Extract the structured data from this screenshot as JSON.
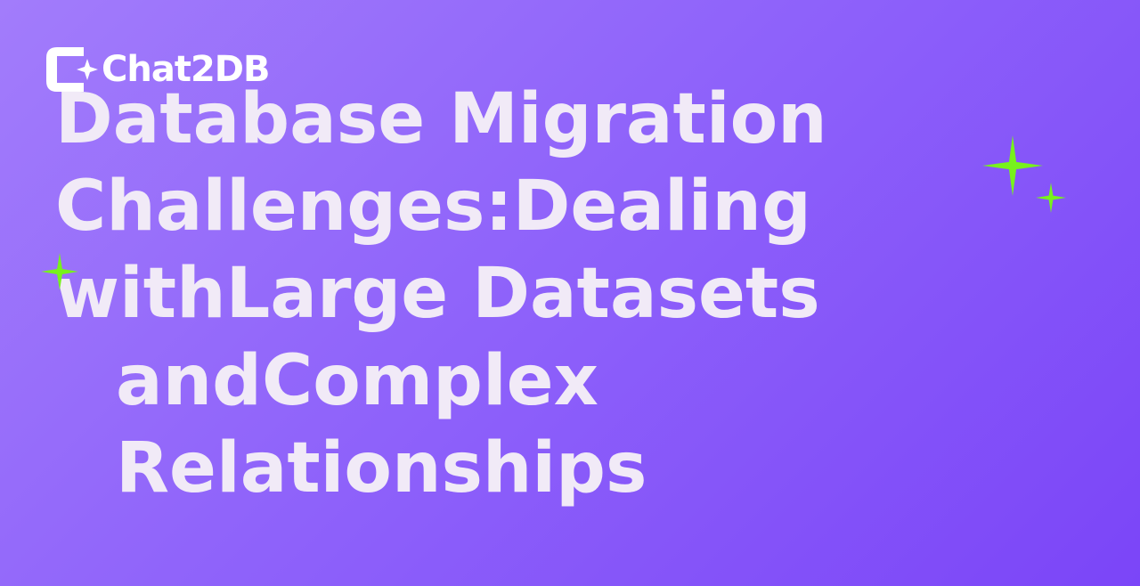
{
  "brand": {
    "name": "Chat2DB"
  },
  "title": {
    "lines": [
      "Database Migration",
      "Challenges:Dealing",
      "withLarge Datasets",
      "andComplex",
      "Relationships"
    ]
  },
  "colors": {
    "background_start": "#a27cfb",
    "background_end": "#7b45f8",
    "title_text": "#f1eaf7",
    "sparkle": "#77f21c",
    "logo": "#ffffff"
  },
  "icons": {
    "logo": "chat2db-logo-icon",
    "sparkle": "sparkle-icon"
  }
}
